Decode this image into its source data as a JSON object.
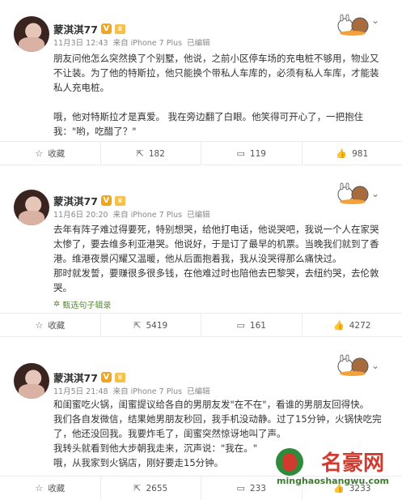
{
  "posts": [
    {
      "username": "蒙淇淇77",
      "vip": "V",
      "crown": "♛",
      "date": "11月3日 12:43",
      "source": "来自 iPhone 7 Plus",
      "edited": "已编辑",
      "lines": [
        "朋友问他怎么突然换了个别墅，他说，之前小区停车场的充电桩不够用，物业又",
        "不让装。为了他的特斯拉，他只能换个带私人车库的，必须有私人车库，才能装",
        "私人充电桩。",
        "",
        "哦，他对特斯拉才是真爱。 我在旁边翻了白眼。他笑得可开心了，一把抱住",
        "我：\"哟，吃醋了？\""
      ],
      "actions": {
        "collect": "收藏",
        "repost": "182",
        "comment": "119",
        "like": "981"
      }
    },
    {
      "username": "蒙淇淇77",
      "vip": "V",
      "crown": "♛",
      "date": "11月6日 20:20",
      "source": "来自 iPhone 7 Plus",
      "edited": "已编辑",
      "lines": [
        "去年有阵子难过得要死，特别想哭，给他打电话，他说哭吧，我说一个人在家哭",
        "太惨了，要去维多利亚港哭。他说好，于是订了最早的机票。当晚我们就到了香",
        "港。维港夜景闪耀又温暖，他从后面抱着我，我从没哭得那么痛快过。",
        "那时就发誓，要赚很多很多钱，在他难过时也陪他去巴黎哭，去纽约哭，去伦敦",
        "哭。"
      ],
      "collect_link": "甄选句子辑录",
      "actions": {
        "collect": "收藏",
        "repost": "5419",
        "comment": "161",
        "like": "4272"
      }
    },
    {
      "username": "蒙淇淇77",
      "vip": "V",
      "crown": "♛",
      "date": "11月5日 21:48",
      "source": "来自 iPhone 7 Plus",
      "edited": "已编辑",
      "lines": [
        "和闺蜜吃火锅，闺蜜提议给各自的男朋友发\"在不在\"，看谁的男朋友回得快。",
        "我们各自发微信，结果她男朋友秒回，我手机没动静。过了15分钟，火锅快吃完",
        "了，他还没回我。我要炸毛了，闺蜜突然惊讶地叫了声。",
        "我转头就看到他大步朝我走来，沉声说：\"我在。\"",
        "哦，从我家到火锅店，刚好要走15分钟。"
      ],
      "actions": {
        "collect": "收藏",
        "repost": "2655",
        "comment": "233",
        "like": "3233"
      }
    }
  ],
  "watermark": {
    "title": "名豪网",
    "url": "minghaoshangwu.com"
  },
  "colors": {
    "vip": "#f0a520",
    "accent_red": "#d13b2f",
    "link_green": "#5a8a3c"
  }
}
